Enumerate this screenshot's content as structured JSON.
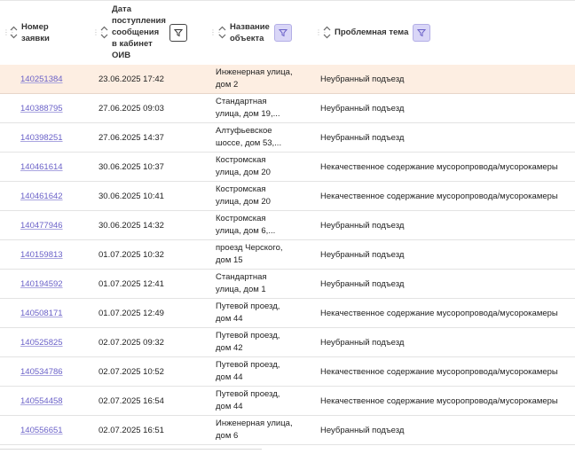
{
  "table": {
    "headers": {
      "number": [
        "Номер",
        "заявки"
      ],
      "date": [
        "Дата",
        "поступления",
        "сообщения",
        "в кабинет",
        "ОИВ"
      ],
      "object": [
        "Название",
        "объекта"
      ],
      "topic": [
        "Проблемная тема"
      ]
    },
    "rows": [
      {
        "number": "140251384",
        "date": "23.06.2025 17:42",
        "object": [
          "Инженерная улица,",
          "дом 2"
        ],
        "topic": "Неубранный подъезд",
        "selected": true
      },
      {
        "number": "140388795",
        "date": "27.06.2025 09:03",
        "object": [
          "Стандартная",
          "улица, дом 19,..."
        ],
        "topic": "Неубранный подъезд"
      },
      {
        "number": "140398251",
        "date": "27.06.2025 14:37",
        "object": [
          "Алтуфьевское",
          "шоссе, дом 53,..."
        ],
        "topic": "Неубранный подъезд"
      },
      {
        "number": "140461614",
        "date": "30.06.2025 10:37",
        "object": [
          "Костромская",
          "улица, дом 20"
        ],
        "topic": "Некачественное содержание мусоропровода/мусорокамеры"
      },
      {
        "number": "140461642",
        "date": "30.06.2025 10:41",
        "object": [
          "Костромская",
          "улица, дом 20"
        ],
        "topic": "Некачественное содержание мусоропровода/мусорокамеры"
      },
      {
        "number": "140477946",
        "date": "30.06.2025 14:32",
        "object": [
          "Костромская",
          "улица, дом 6,..."
        ],
        "topic": "Неубранный подъезд"
      },
      {
        "number": "140159813",
        "date": "01.07.2025 10:32",
        "object": [
          "проезд Черского,",
          "дом 15"
        ],
        "topic": "Неубранный подъезд"
      },
      {
        "number": "140194592",
        "date": "01.07.2025 12:41",
        "object": [
          "Стандартная",
          "улица, дом 1"
        ],
        "topic": "Неубранный подъезд"
      },
      {
        "number": "140508171",
        "date": "01.07.2025 12:49",
        "object": [
          "Путевой проезд,",
          "дом 44"
        ],
        "topic": "Некачественное содержание мусоропровода/мусорокамеры"
      },
      {
        "number": "140525825",
        "date": "02.07.2025 09:32",
        "object": [
          "Путевой проезд,",
          "дом 42"
        ],
        "topic": "Неубранный подъезд"
      },
      {
        "number": "140534786",
        "date": "02.07.2025 10:52",
        "object": [
          "Путевой проезд,",
          "дом 44"
        ],
        "topic": "Некачественное содержание мусоропровода/мусорокамеры"
      },
      {
        "number": "140554458",
        "date": "02.07.2025 16:54",
        "object": [
          "Путевой проезд,",
          "дом 44"
        ],
        "topic": "Некачественное содержание мусоропровода/мусорокамеры"
      },
      {
        "number": "140556651",
        "date": "02.07.2025 16:51",
        "object": [
          "Инженерная улица,",
          "дом 6"
        ],
        "topic": "Неубранный подъезд"
      }
    ]
  },
  "colors": {
    "link": "#6a61c8",
    "selected_row": "#fdeee2",
    "active_filter": "#d9d6f7"
  },
  "icons": {
    "sort": "sort-arrows-icon",
    "filter": "filter-funnel-icon",
    "drag": "drag-handle-icon"
  }
}
